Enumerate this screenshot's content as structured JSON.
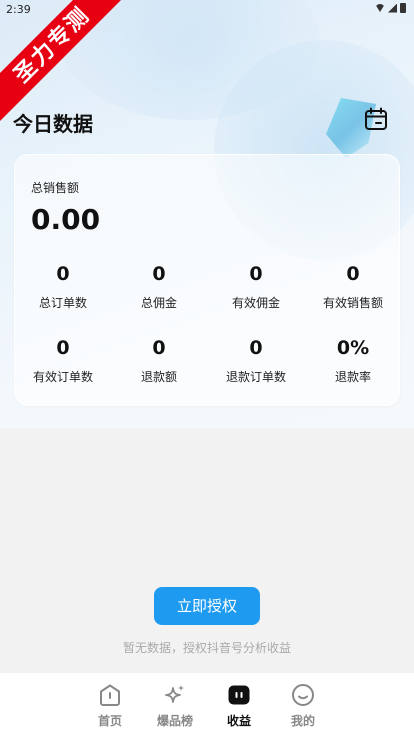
{
  "status_bar": {
    "time": "2:39"
  },
  "ribbon": {
    "text": "圣力专测"
  },
  "header": {
    "title": "今日数据"
  },
  "summary": {
    "label": "总销售额",
    "amount": "0.00"
  },
  "stats": [
    {
      "value": "0",
      "label": "总订单数"
    },
    {
      "value": "0",
      "label": "总佣金"
    },
    {
      "value": "0",
      "label": "有效佣金"
    },
    {
      "value": "0",
      "label": "有效销售额"
    },
    {
      "value": "0",
      "label": "有效订单数"
    },
    {
      "value": "0",
      "label": "退款额"
    },
    {
      "value": "0",
      "label": "退款订单数"
    },
    {
      "value": "0%",
      "label": "退款率"
    }
  ],
  "empty_state": {
    "button_label": "立即授权",
    "message": "暂无数据，授权抖音号分析收益"
  },
  "tabbar": {
    "items": [
      {
        "label": "首页",
        "icon": "home-icon"
      },
      {
        "label": "爆品榜",
        "icon": "sparkle-icon"
      },
      {
        "label": "收益",
        "icon": "earnings-icon",
        "active": true
      },
      {
        "label": "我的",
        "icon": "profile-icon"
      }
    ]
  },
  "colors": {
    "primary": "#1e9bf0",
    "ribbon": "#e60012",
    "inactive_tab": "#888888"
  }
}
